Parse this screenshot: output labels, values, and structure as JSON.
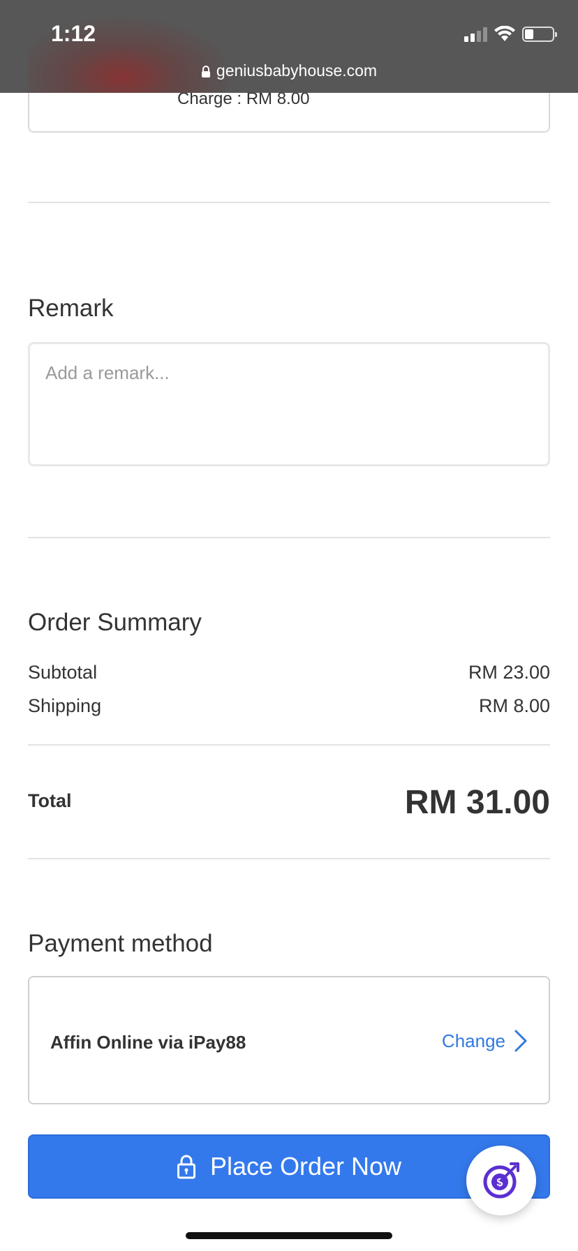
{
  "status_bar": {
    "time": "1:12",
    "url": "geniusbabyhouse.com"
  },
  "previous_card": {
    "charge_text": "Charge : RM 8.00"
  },
  "remark": {
    "title": "Remark",
    "placeholder": "Add a remark...",
    "value": ""
  },
  "order_summary": {
    "title": "Order Summary",
    "subtotal_label": "Subtotal",
    "subtotal_value": "RM 23.00",
    "shipping_label": "Shipping",
    "shipping_value": "RM 8.00",
    "total_label": "Total",
    "total_value": "RM 31.00"
  },
  "payment": {
    "title": "Payment method",
    "method": "Affin Online via iPay88",
    "change_label": "Change"
  },
  "place_order": {
    "label": "Place Order Now"
  },
  "colors": {
    "accent": "#3479ec",
    "link": "#2f7ae0",
    "text": "#333333",
    "statusbar": "#575757"
  },
  "icons": [
    "lock-icon",
    "chevron-right-icon",
    "signal-icon",
    "wifi-icon",
    "battery-icon",
    "target-dollar-icon"
  ]
}
